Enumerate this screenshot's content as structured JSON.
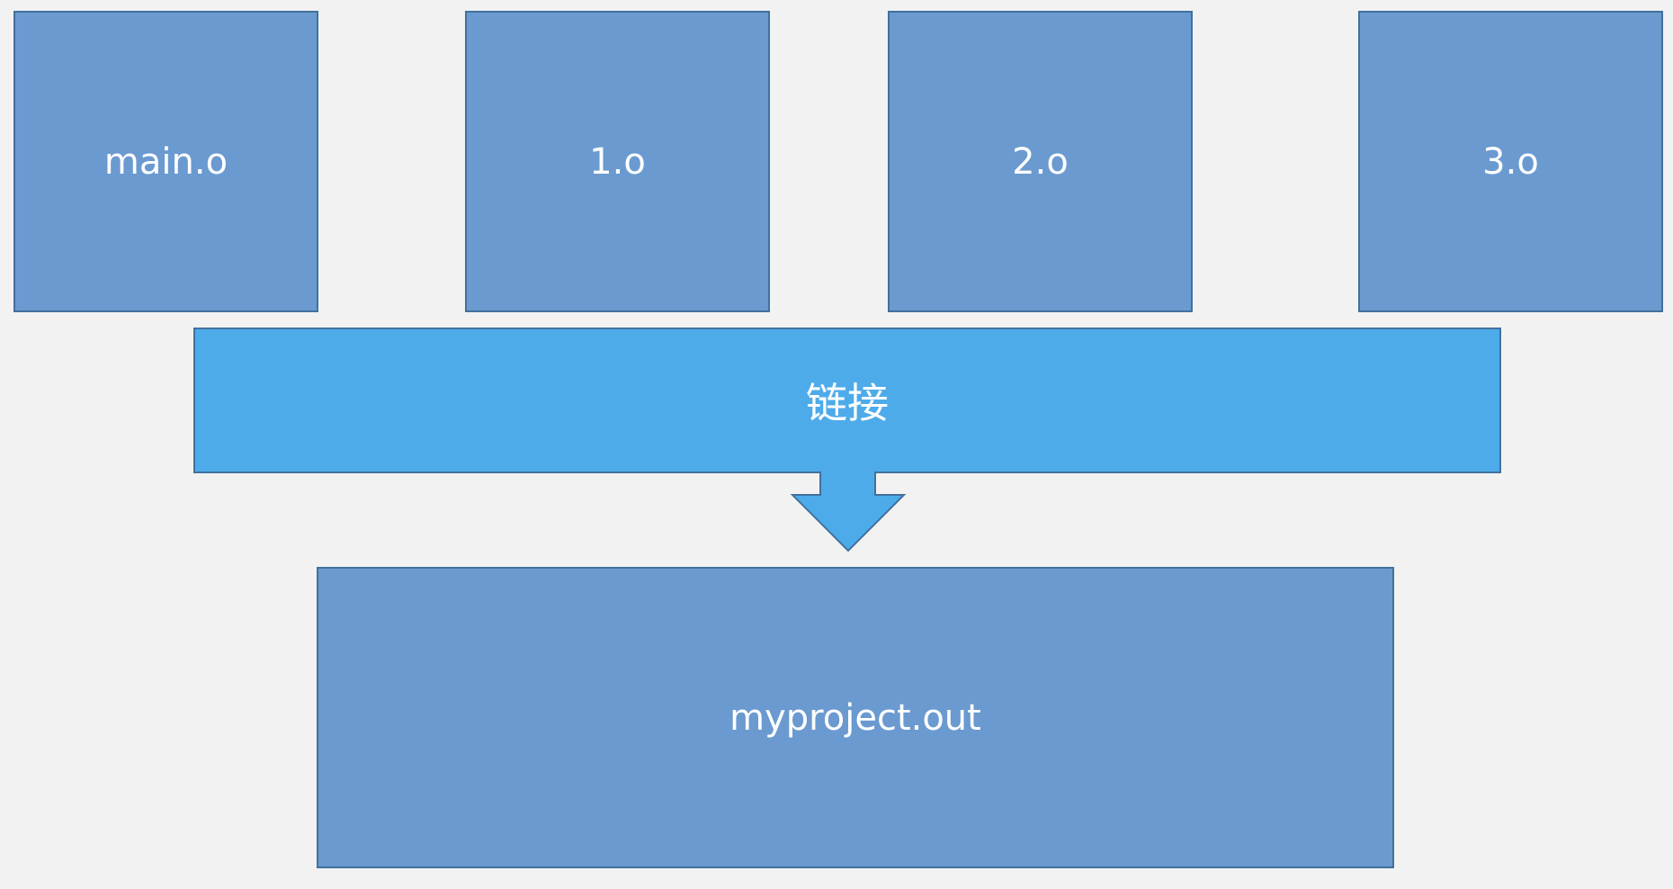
{
  "nodes": {
    "main_o": "main.o",
    "one_o": "1.o",
    "two_o": "2.o",
    "three_o": "3.o",
    "output": "myproject.out"
  },
  "link_step": "链接",
  "colors": {
    "background": "#f2f2f2",
    "object_box": "#6a9ad0",
    "link_arrow": "#4eabea",
    "border": "#41719c",
    "text": "#ffffff"
  }
}
